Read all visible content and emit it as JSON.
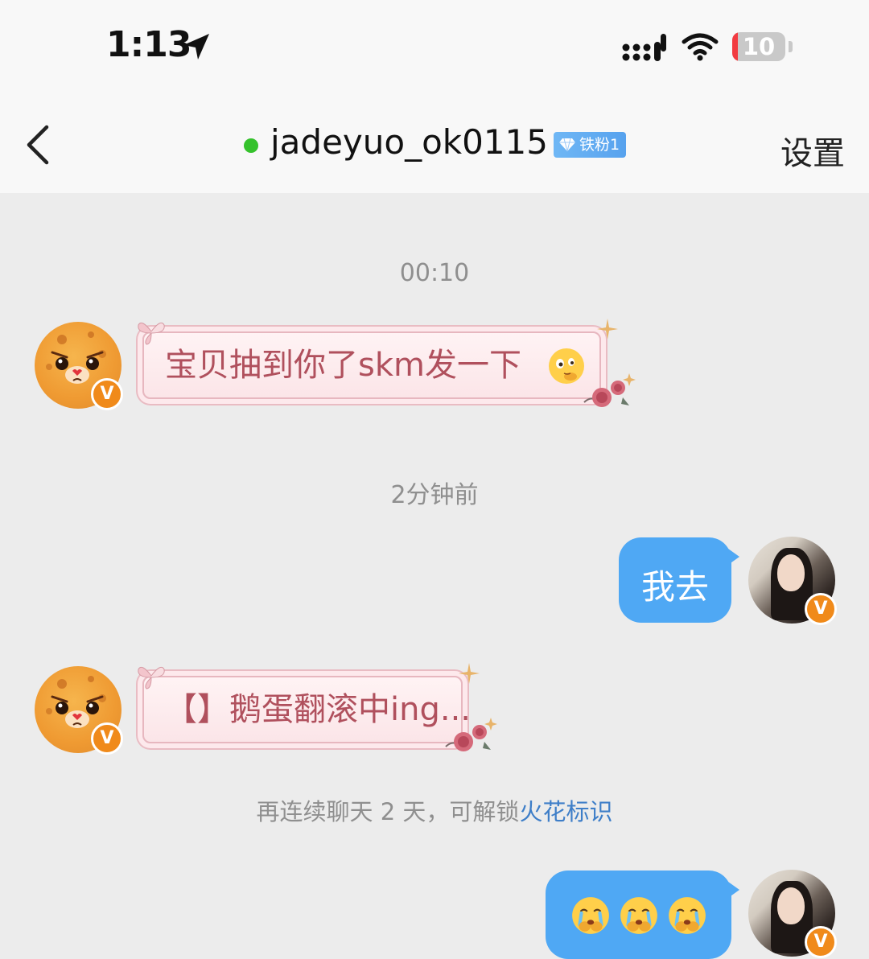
{
  "status_bar": {
    "time": "1:13",
    "battery_level": "10",
    "battery_fraction": 0.1
  },
  "nav": {
    "title": "jadeyuo_ok0115",
    "fan_badge": "铁粉1",
    "settings_label": "设置",
    "online_color": "#35c22c"
  },
  "chat": {
    "timestamp_1": "00:10",
    "message_1": "宝贝抽到你了skm发一下",
    "timestamp_2": "2分钟前",
    "message_2": "我去",
    "message_3": "【】鹅蛋翻滚中ing...",
    "notice_prefix": "再连续聊天 2 天，可解锁",
    "notice_link": "火花标识",
    "message_4_emoji_count": 3,
    "verified_badge": "V"
  },
  "icons": {
    "back": "chevron-left-icon",
    "location": "location-arrow-icon",
    "signal": "cellular-signal-icon",
    "wifi": "wifi-icon",
    "battery": "battery-icon",
    "emoji_1": "thinking-emoji-icon",
    "emoji_4": "crying-emoji-icon"
  },
  "colors": {
    "accent_blue": "#4fa8f4",
    "pink_text": "#b0505d",
    "link_blue": "#3e7ec8",
    "badge_orange": "#f08a1a"
  }
}
